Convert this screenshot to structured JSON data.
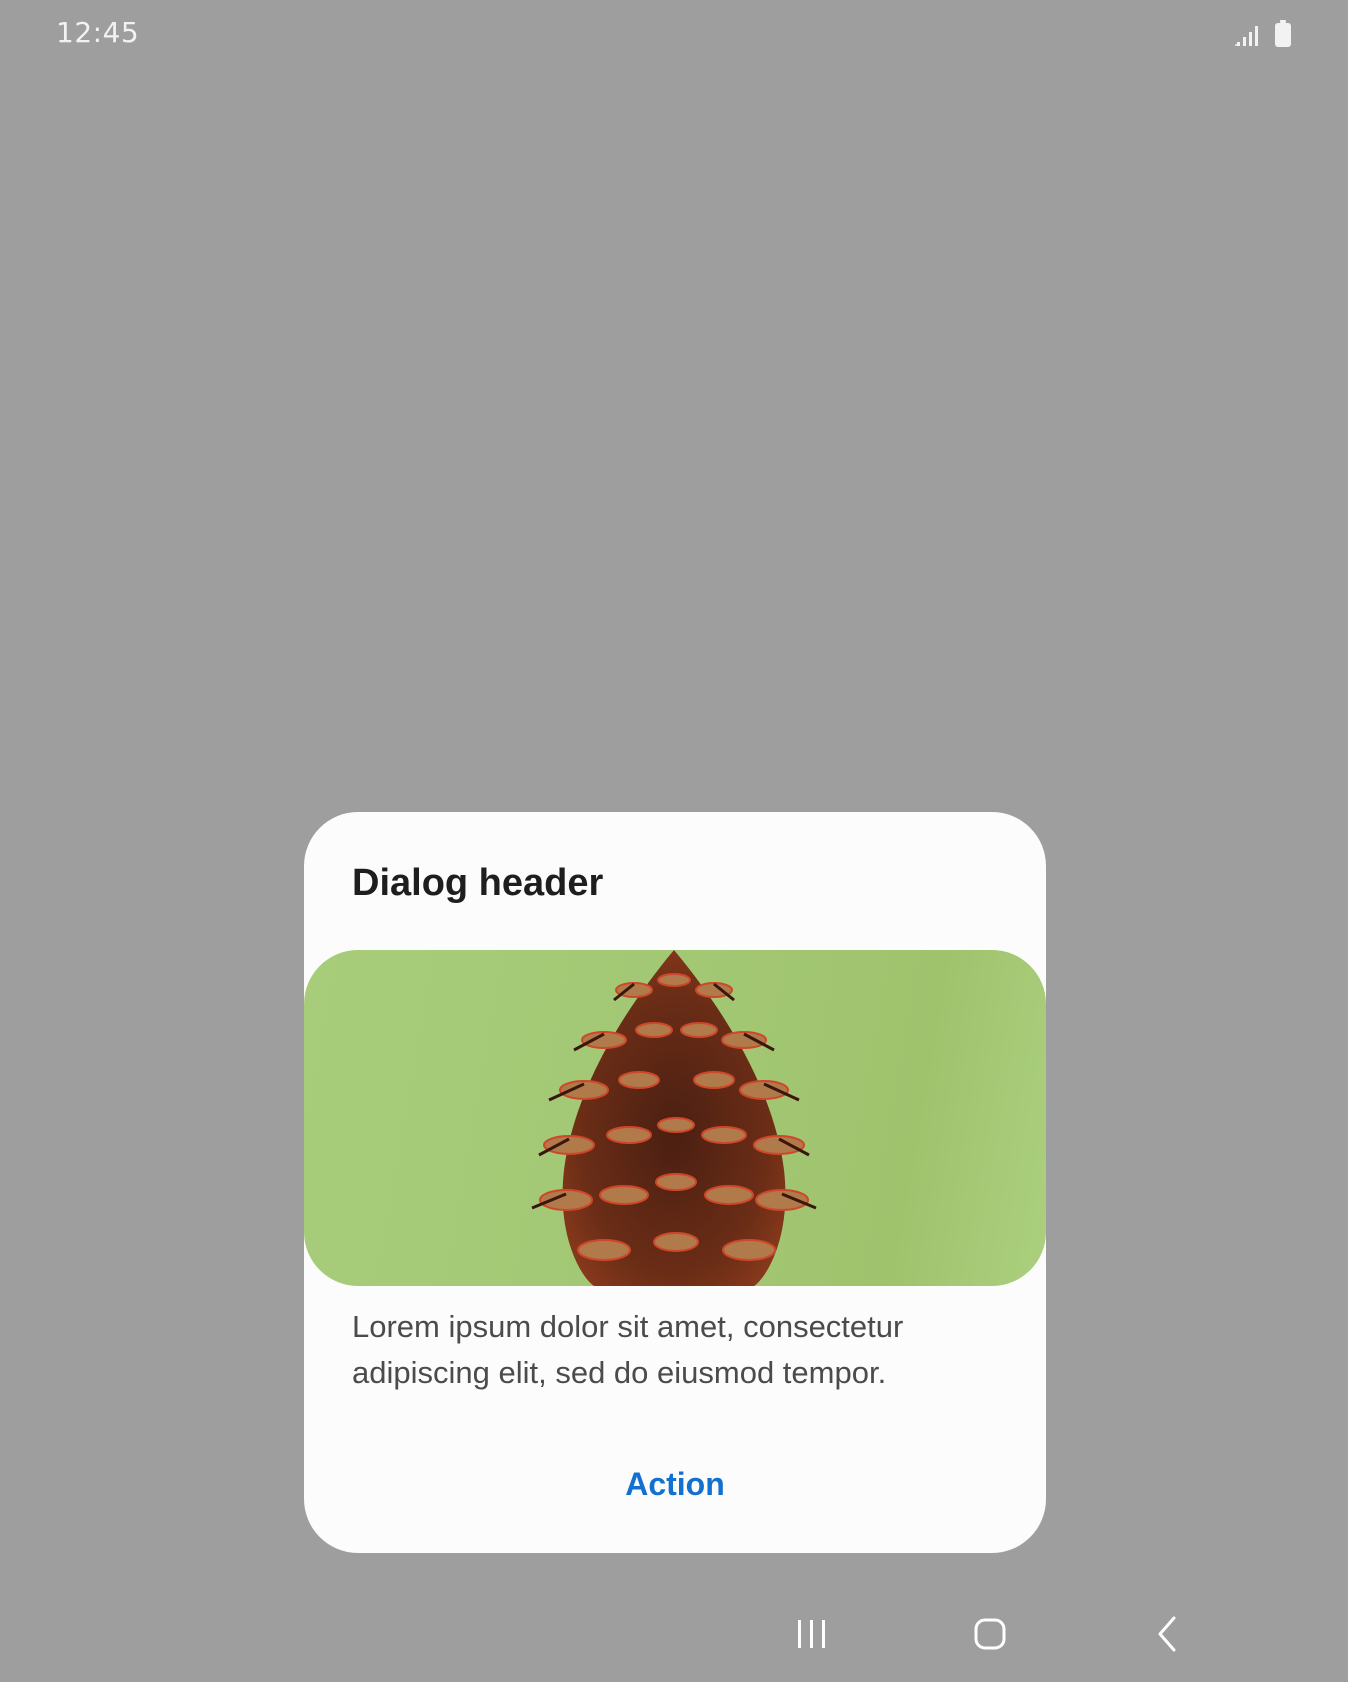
{
  "status_bar": {
    "time": "12:45",
    "icons": [
      "signal-icon",
      "battery-icon"
    ]
  },
  "dialog": {
    "header": "Dialog header",
    "image": "pinecone-image",
    "body": "Lorem ipsum dolor sit amet, consectetur adipiscing elit, sed do eiusmod tempor.",
    "action_label": "Action"
  },
  "nav_bar": {
    "icons": [
      "recents-icon",
      "home-icon",
      "back-icon"
    ]
  },
  "colors": {
    "scrim": "#9e9e9e",
    "dialog_bg": "#fcfcfc",
    "accent": "#1270d0",
    "image_bg": "#a5ca78"
  }
}
